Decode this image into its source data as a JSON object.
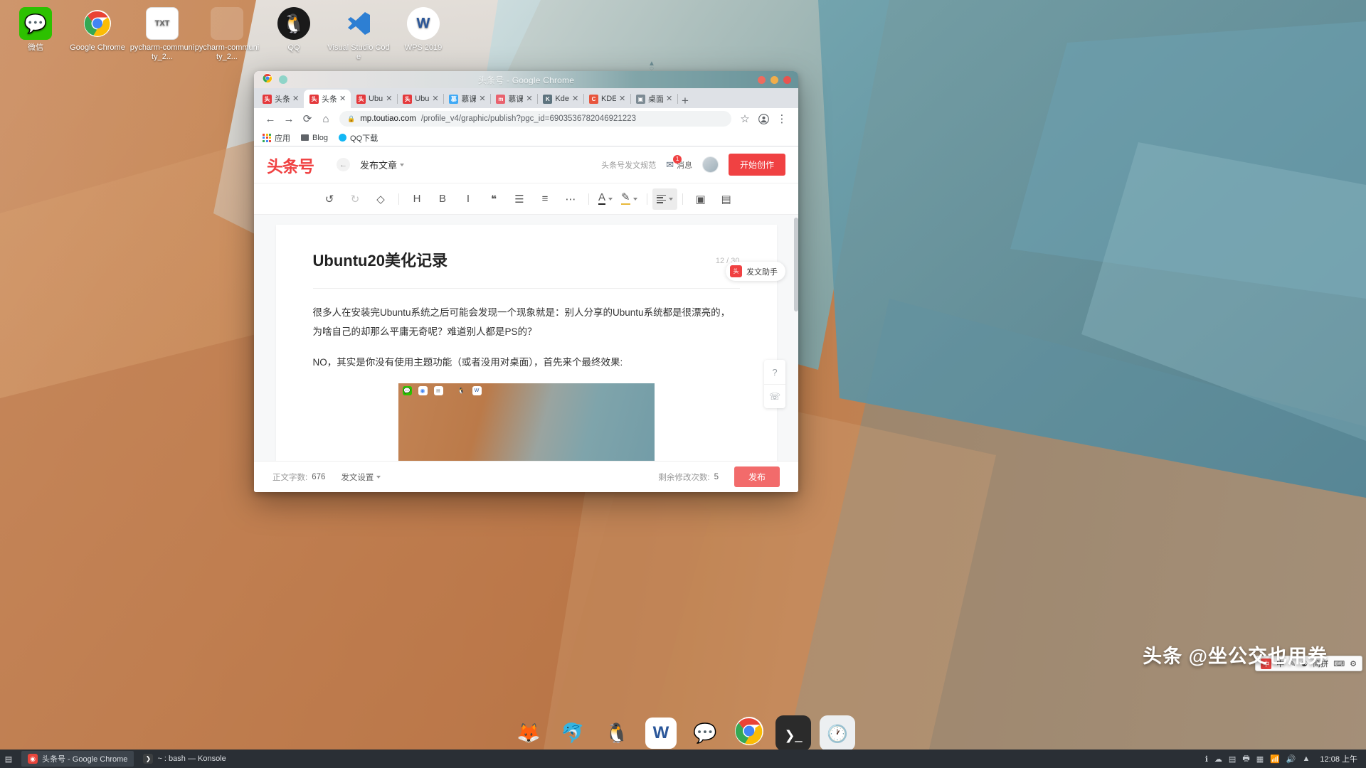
{
  "desktop": {
    "icons": [
      {
        "name": "wechat",
        "label": "微信",
        "glyph": "💬",
        "color": "#2dc100"
      },
      {
        "name": "google-chrome",
        "label": "Google Chrome",
        "glyph": "◉",
        "color": "#ffffff"
      },
      {
        "name": "pycharm-community-txt",
        "label": "pycharm-community_2...",
        "glyph": "TXT",
        "color": "#ffffff"
      },
      {
        "name": "pycharm-community-2",
        "label": "pycharm-community_2...",
        "glyph": "",
        "color": "#ffffff"
      },
      {
        "name": "qq",
        "label": "QQ",
        "glyph": "🐧",
        "color": "#12b7f5"
      },
      {
        "name": "visual-studio-code",
        "label": "Visual Studio Code",
        "glyph": "◣",
        "color": "#2d7fd3"
      },
      {
        "name": "wps-2019",
        "label": "WPS 2019",
        "glyph": "W",
        "color": "#2a5699"
      }
    ]
  },
  "window": {
    "title": "头条号 - Google Chrome",
    "controls": [
      "close",
      "minimize",
      "maximize"
    ]
  },
  "tabs": [
    {
      "label": "头条",
      "favicon": "头条",
      "fav_color": "#e4393c",
      "active": false
    },
    {
      "label": "头条",
      "favicon": "头条",
      "fav_color": "#e4393c",
      "active": true
    },
    {
      "label": "Ubu",
      "favicon": "头条",
      "fav_color": "#e4393c",
      "active": false
    },
    {
      "label": "Ubu",
      "favicon": "头条",
      "fav_color": "#e4393c",
      "active": false
    },
    {
      "label": "慕课",
      "favicon": "慕",
      "fav_color": "#3fa9f5",
      "active": false
    },
    {
      "label": "慕课",
      "favicon": "m",
      "fav_color": "#e9626e",
      "active": false
    },
    {
      "label": "Kde",
      "favicon": "K",
      "fav_color": "#5d737e",
      "active": false
    },
    {
      "label": "KDE",
      "favicon": "C",
      "fav_color": "#e8553d",
      "active": false
    },
    {
      "label": "桌面",
      "favicon": "▣",
      "fav_color": "#7d8b94",
      "active": false
    }
  ],
  "newtab_label": "+",
  "nav": {
    "back": "←",
    "forward": "→",
    "reload": "⟳",
    "home": "⌂",
    "lock": "🔒",
    "url_host": "mp.toutiao.com",
    "url_path": "/profile_v4/graphic/publish?pgc_id=6903536782046921223",
    "star": "☆",
    "profile": "◍",
    "menu": "⋮"
  },
  "bookmarks": [
    {
      "name": "apps",
      "label": "应用"
    },
    {
      "name": "blog",
      "label": "Blog"
    },
    {
      "name": "qq-download",
      "label": "QQ下载"
    }
  ],
  "toutiao": {
    "logo": "头条号",
    "back_arrow": "←",
    "breadcrumb": "发布文章",
    "spec_link": "头条号发文规范",
    "message_label": "消息",
    "message_badge": "1",
    "create_button": "开始创作",
    "toolbar": [
      {
        "name": "undo",
        "glyph": "↺",
        "state": "normal"
      },
      {
        "name": "redo",
        "glyph": "↻",
        "state": "dim"
      },
      {
        "name": "clear-format",
        "glyph": "◇",
        "state": "normal"
      },
      {
        "name": "heading",
        "glyph": "H",
        "state": "normal"
      },
      {
        "name": "bold",
        "glyph": "B",
        "state": "normal"
      },
      {
        "name": "italic",
        "glyph": "I",
        "state": "normal"
      },
      {
        "name": "quote",
        "glyph": "❝",
        "state": "normal"
      },
      {
        "name": "bullet-list",
        "glyph": "☰",
        "state": "normal"
      },
      {
        "name": "numbered-list",
        "glyph": "≡",
        "state": "normal"
      },
      {
        "name": "more",
        "glyph": "⋯",
        "state": "normal"
      },
      {
        "name": "font-color",
        "glyph": "A",
        "state": "normal"
      },
      {
        "name": "highlight-color",
        "glyph": "✎",
        "state": "normal"
      },
      {
        "name": "align",
        "glyph": "≣",
        "state": "active"
      },
      {
        "name": "insert-image",
        "glyph": "▣",
        "state": "normal"
      },
      {
        "name": "insert-document",
        "glyph": "▤",
        "state": "normal"
      }
    ],
    "article": {
      "title": "Ubuntu20美化记录",
      "title_count": "12 / 30",
      "paragraphs": [
        "很多人在安装完Ubuntu系统之后可能会发现一个现象就是：别人分享的Ubuntu系统都是很漂亮的，为啥自己的却那么平庸无奇呢？难道别人都是PS的？",
        "NO，其实是你没有使用主题功能（或者没用对桌面），首先来个最终效果:"
      ]
    },
    "helper": {
      "label": "发文助手",
      "icon": "头"
    },
    "side_tools": [
      {
        "name": "help",
        "glyph": "?"
      },
      {
        "name": "feedback",
        "glyph": "☏"
      }
    ],
    "footer": {
      "word_count_label": "正文字数:",
      "word_count_value": "676",
      "settings_label": "发文设置",
      "remaining_label": "剩余修改次数:",
      "remaining_value": "5",
      "publish_button": "发布"
    }
  },
  "dock": [
    {
      "name": "firefox",
      "glyph": "🦊",
      "color": "#ff7139"
    },
    {
      "name": "dolphin",
      "glyph": "🐬",
      "color": "#3daee9"
    },
    {
      "name": "qq",
      "glyph": "🐧",
      "color": "#12b7f5"
    },
    {
      "name": "wps-writer",
      "glyph": "W",
      "color": "#2a5699"
    },
    {
      "name": "wechat",
      "glyph": "💬",
      "color": "#2dc100"
    },
    {
      "name": "google-chrome",
      "glyph": "◉",
      "color": "#ffffff"
    },
    {
      "name": "terminal",
      "glyph": "❯_",
      "color": "#2b2b2b"
    },
    {
      "name": "clock",
      "glyph": "🕐",
      "color": "#eceff1"
    }
  ],
  "taskbar": {
    "launcher": "▤",
    "items": [
      {
        "name": "chrome-task",
        "label": "头条号 - Google Chrome",
        "icon": "◉",
        "color": "#e8453c",
        "selected": true
      },
      {
        "name": "konsole-task",
        "label": "~ : bash — Konsole",
        "icon": "❯",
        "color": "#3c3f41",
        "selected": false
      }
    ],
    "tray": [
      "ℹ",
      "☁",
      "▤",
      "🖶",
      "▦",
      "📶",
      "🔊",
      "▲"
    ],
    "clock": "12:08 上午"
  },
  "ime": {
    "logo": "中",
    "items": [
      "中",
      "✎",
      "☯",
      "简拼",
      "⌨",
      "⚙"
    ]
  },
  "watermark": "头条 @坐公交也用券",
  "colors": {
    "brand_red": "#f04142",
    "publish_red": "#f26b6b",
    "taskbar_bg": "#2a2f35",
    "tabstrip_bg": "#dee1e6"
  }
}
